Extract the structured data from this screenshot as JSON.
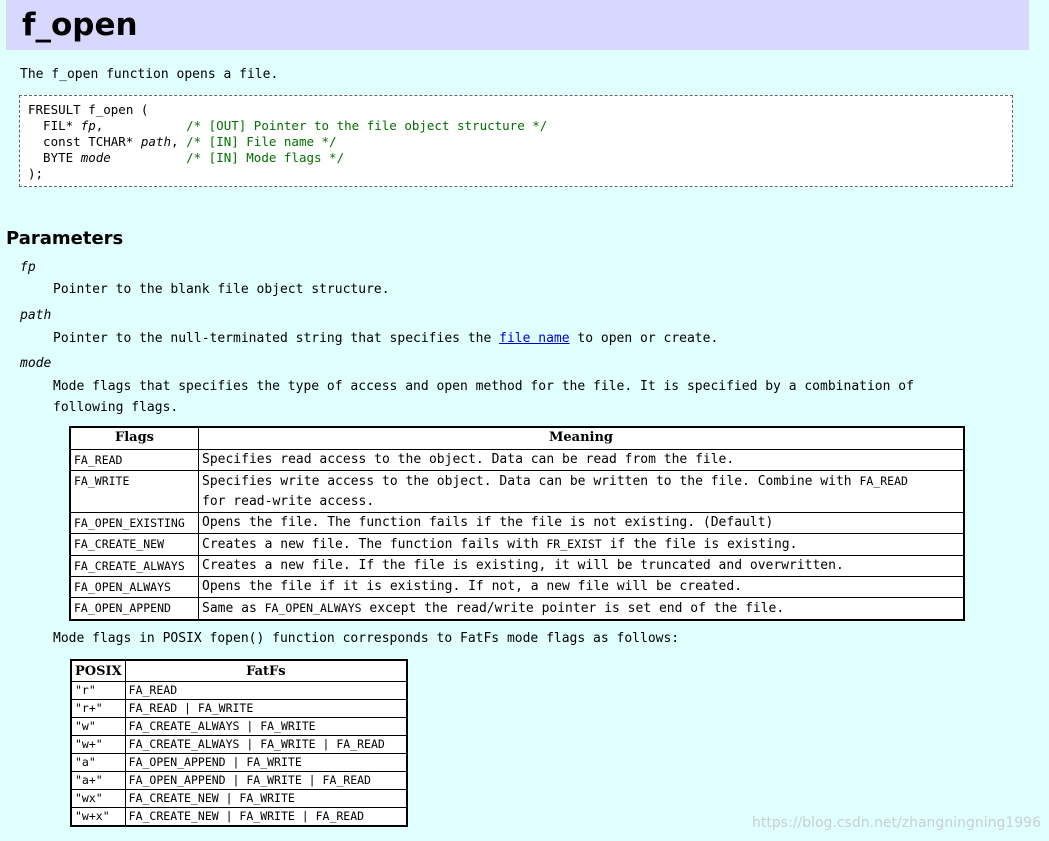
{
  "title": "f_open",
  "intro": "The f_open function opens a file.",
  "code": {
    "line1": "FRESULT f_open (",
    "params": [
      {
        "type": "  FIL* ",
        "name": "fp",
        "sep": ",",
        "pad": "           ",
        "comment": "/* [OUT] Pointer to the file object structure */"
      },
      {
        "type": "  const TCHAR* ",
        "name": "path",
        "sep": ",",
        "pad": " ",
        "comment": "/* [IN] File name */"
      },
      {
        "type": "  BYTE ",
        "name": "mode",
        "sep": "",
        "pad": "          ",
        "comment": "/* [IN] Mode flags */"
      }
    ],
    "close": ");"
  },
  "parameters_heading": "Parameters",
  "fp": {
    "term": "fp",
    "desc": "Pointer to the blank file object structure."
  },
  "path": {
    "term": "path",
    "desc_before": "Pointer to the null-terminated string that specifies the ",
    "link": "file name",
    "desc_after": " to open or create."
  },
  "mode": {
    "term": "mode",
    "desc": "Mode flags that specifies the type of access and open method for the file. It is specified by a combination of following flags."
  },
  "flags_table": {
    "headers": [
      "Flags",
      "Meaning"
    ],
    "rows": [
      {
        "flag": "FA_READ",
        "meaning": "Specifies read access to the object. Data can be read from the file."
      },
      {
        "flag": "FA_WRITE",
        "m1": "Specifies write access to the object. Data can be written to the file. Combine with ",
        "code": "FA_READ",
        "m2": " for read-write access."
      },
      {
        "flag": "FA_OPEN_EXISTING",
        "meaning": "Opens the file. The function fails if the file is not existing. (Default)"
      },
      {
        "flag": "FA_CREATE_NEW",
        "m1": "Creates a new file. The function fails with ",
        "code": "FR_EXIST",
        "m2": " if the file is existing."
      },
      {
        "flag": "FA_CREATE_ALWAYS",
        "meaning": "Creates a new file. If the file is existing, it will be truncated and overwritten."
      },
      {
        "flag": "FA_OPEN_ALWAYS",
        "meaning": "Opens the file if it is existing. If not, a new file will be created."
      },
      {
        "flag": "FA_OPEN_APPEND",
        "m1": "Same as ",
        "code": "FA_OPEN_ALWAYS",
        "m2": " except the read/write pointer is set end of the file."
      }
    ]
  },
  "posix_intro": "Mode flags in POSIX fopen() function corresponds to FatFs mode flags as follows:",
  "posix_table": {
    "headers": [
      "POSIX",
      "FatFs"
    ],
    "rows": [
      [
        "\"r\"",
        "FA_READ"
      ],
      [
        "\"r+\"",
        "FA_READ | FA_WRITE"
      ],
      [
        "\"w\"",
        "FA_CREATE_ALWAYS | FA_WRITE"
      ],
      [
        "\"w+\"",
        "FA_CREATE_ALWAYS | FA_WRITE | FA_READ"
      ],
      [
        "\"a\"",
        "FA_OPEN_APPEND | FA_WRITE"
      ],
      [
        "\"a+\"",
        "FA_OPEN_APPEND | FA_WRITE | FA_READ"
      ],
      [
        "\"wx\"",
        "FA_CREATE_NEW | FA_WRITE"
      ],
      [
        "\"w+x\"",
        "FA_CREATE_NEW | FA_WRITE | FA_READ"
      ]
    ]
  },
  "watermark": "https://blog.csdn.net/zhangningning1996"
}
